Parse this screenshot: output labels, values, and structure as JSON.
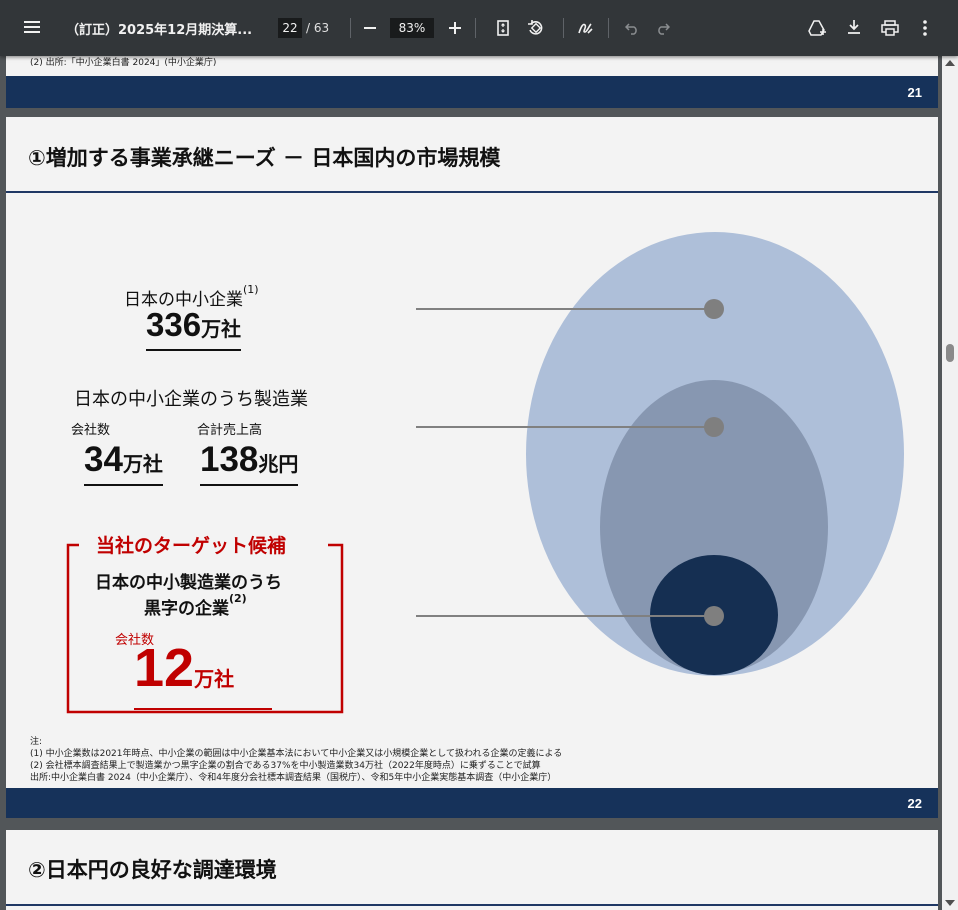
{
  "toolbar": {
    "doc_title": "（訂正）2025年12月期決算...",
    "current_page": "22",
    "page_total": "/ 63",
    "zoom": "83%"
  },
  "page21": {
    "notes": [
      "(2)  出所:「中小企業白書 2024」(中小企業庁)"
    ],
    "page_number": "21"
  },
  "page22": {
    "title": "①増加する事業承継ニーズ － 日本国内の市場規模",
    "block1": {
      "label": "日本の中小企業",
      "label_sup": "(1)",
      "value": "336",
      "unit": "万社"
    },
    "block2": {
      "label": "日本の中小企業のうち製造業",
      "sub1_label": "会社数",
      "sub1_value": "34",
      "sub1_unit": "万社",
      "sub2_label": "合計売上高",
      "sub2_value": "138",
      "sub2_unit": "兆円"
    },
    "target": {
      "heading": "当社のターゲット候補",
      "line1": "日本の中小製造業のうち",
      "line2": "黒字の企業",
      "line2_sup": "(2)",
      "sub_label": "会社数",
      "value": "12",
      "unit": "万社"
    },
    "notes": [
      "注:",
      "(1)  中小企業数は2021年時点、中小企業の範囲は中小企業基本法において中小企業又は小規模企業として扱われる企業の定義による",
      "(2)  会社標本調査結果上で製造業かつ黒字企業の割合である37%を中小製造業数34万社（2022年度時点）に乗ずることで試算",
      "出所:中小企業白書 2024（中小企業庁）、令和4年度分会社標本調査結果（国税庁）、令和5年中小企業実態基本調査（中小企業庁）"
    ],
    "page_number": "22"
  },
  "page23": {
    "title": "②日本円の良好な調達環境"
  },
  "colors": {
    "navy": "#16325a",
    "accent_red": "#c00000",
    "circle_outer": "#aebfd9",
    "circle_middle": "#8797b1",
    "circle_inner": "#152f52"
  }
}
